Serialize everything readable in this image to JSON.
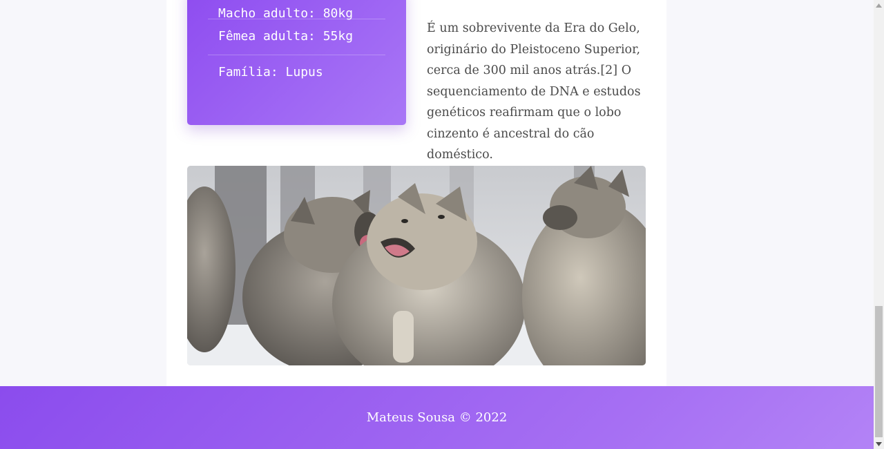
{
  "facts": {
    "items": [
      "Macho adulto: 80kg",
      "Fêmea adulta: 55kg",
      "Família: Lupus"
    ]
  },
  "article": {
    "paragraph": "É um sobrevivente da Era do Gelo, originário do Pleistoceno Superior, cerca de 300 mil anos atrás.[2] O sequenciamento de DNA e estudos genéticos reafirmam que o lobo cinzento é ancestral do cão doméstico."
  },
  "footer": {
    "text": "Mateus Sousa © 2022"
  },
  "colors": {
    "accent_start": "#8e4cf0",
    "accent_end": "#a977f6",
    "page_bg": "#f7f7fb",
    "text": "#4a4a4a"
  }
}
